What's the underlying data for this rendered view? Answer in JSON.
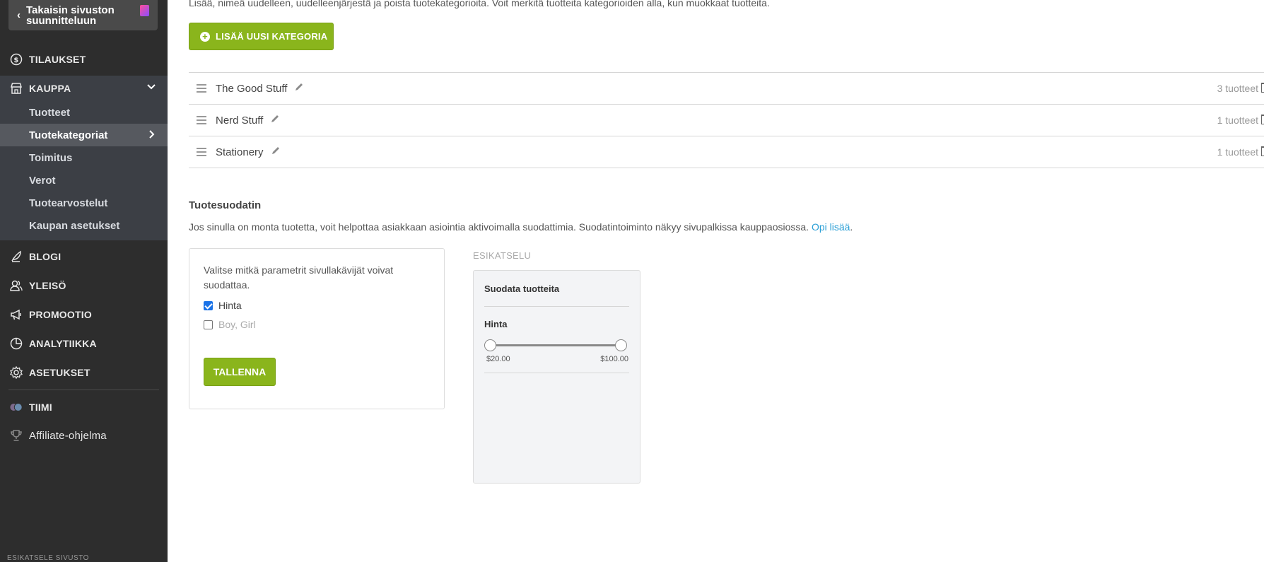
{
  "sidebar": {
    "back_label": "Takaisin sivuston suunnitteluun",
    "items": [
      {
        "label": "TILAUKSET",
        "icon": "dollar-circle-icon"
      },
      {
        "label": "KAUPPA",
        "icon": "store-icon"
      },
      {
        "label": "BLOGI",
        "icon": "feather-icon"
      },
      {
        "label": "YLEISÖ",
        "icon": "users-icon"
      },
      {
        "label": "PROMOOTIO",
        "icon": "megaphone-icon"
      },
      {
        "label": "ANALYTIIKKA",
        "icon": "pie-chart-icon"
      },
      {
        "label": "ASETUKSET",
        "icon": "gear-icon"
      },
      {
        "label": "TIIMI",
        "icon": "team-avatars-icon"
      },
      {
        "label": "Affiliate-ohjelma",
        "icon": "trophy-icon"
      }
    ],
    "submenu": [
      {
        "label": "Tuotteet"
      },
      {
        "label": "Tuotekategoriat"
      },
      {
        "label": "Toimitus"
      },
      {
        "label": "Verot"
      },
      {
        "label": "Tuotearvostelut"
      },
      {
        "label": "Kaupan asetukset"
      }
    ],
    "footer": "ESIKATSELE SIVUSTO"
  },
  "main": {
    "description": "Lisää, nimeä uudelleen, uudelleenjärjestä ja poista tuotekategorioita. Voit merkitä tuotteita kategorioiden alla, kun muokkaat tuotteita.",
    "add_button": "LISÄÄ UUSI KATEGORIA",
    "categories": [
      {
        "name": "The Good Stuff",
        "count": "3 tuotteet"
      },
      {
        "name": "Nerd Stuff",
        "count": "1 tuotteet"
      },
      {
        "name": "Stationery",
        "count": "1 tuotteet"
      }
    ],
    "filter": {
      "title": "Tuotesuodatin",
      "description": "Jos sinulla on monta tuotetta, voit helpottaa asiakkaan asiointia aktivoimalla suodattimia. Suodatintoiminto näkyy sivupalkissa kauppaosiossa.",
      "link": "Opi lisää",
      "period": ".",
      "params_text": "Valitse mitkä parametrit sivullakävijät voivat suodattaa.",
      "options": [
        {
          "label": "Hinta",
          "checked": true
        },
        {
          "label": "Boy, Girl",
          "checked": false
        }
      ],
      "save_button": "TALLENNA"
    },
    "preview": {
      "label": "ESIKATSELU",
      "title": "Suodata tuotteita",
      "section": "Hinta",
      "min": "$20.00",
      "max": "$100.00"
    }
  },
  "colors": {
    "sidebar_bg": "#2d2d2d",
    "accent_green": "#8ab51c",
    "link_blue": "#2a9fd6"
  }
}
